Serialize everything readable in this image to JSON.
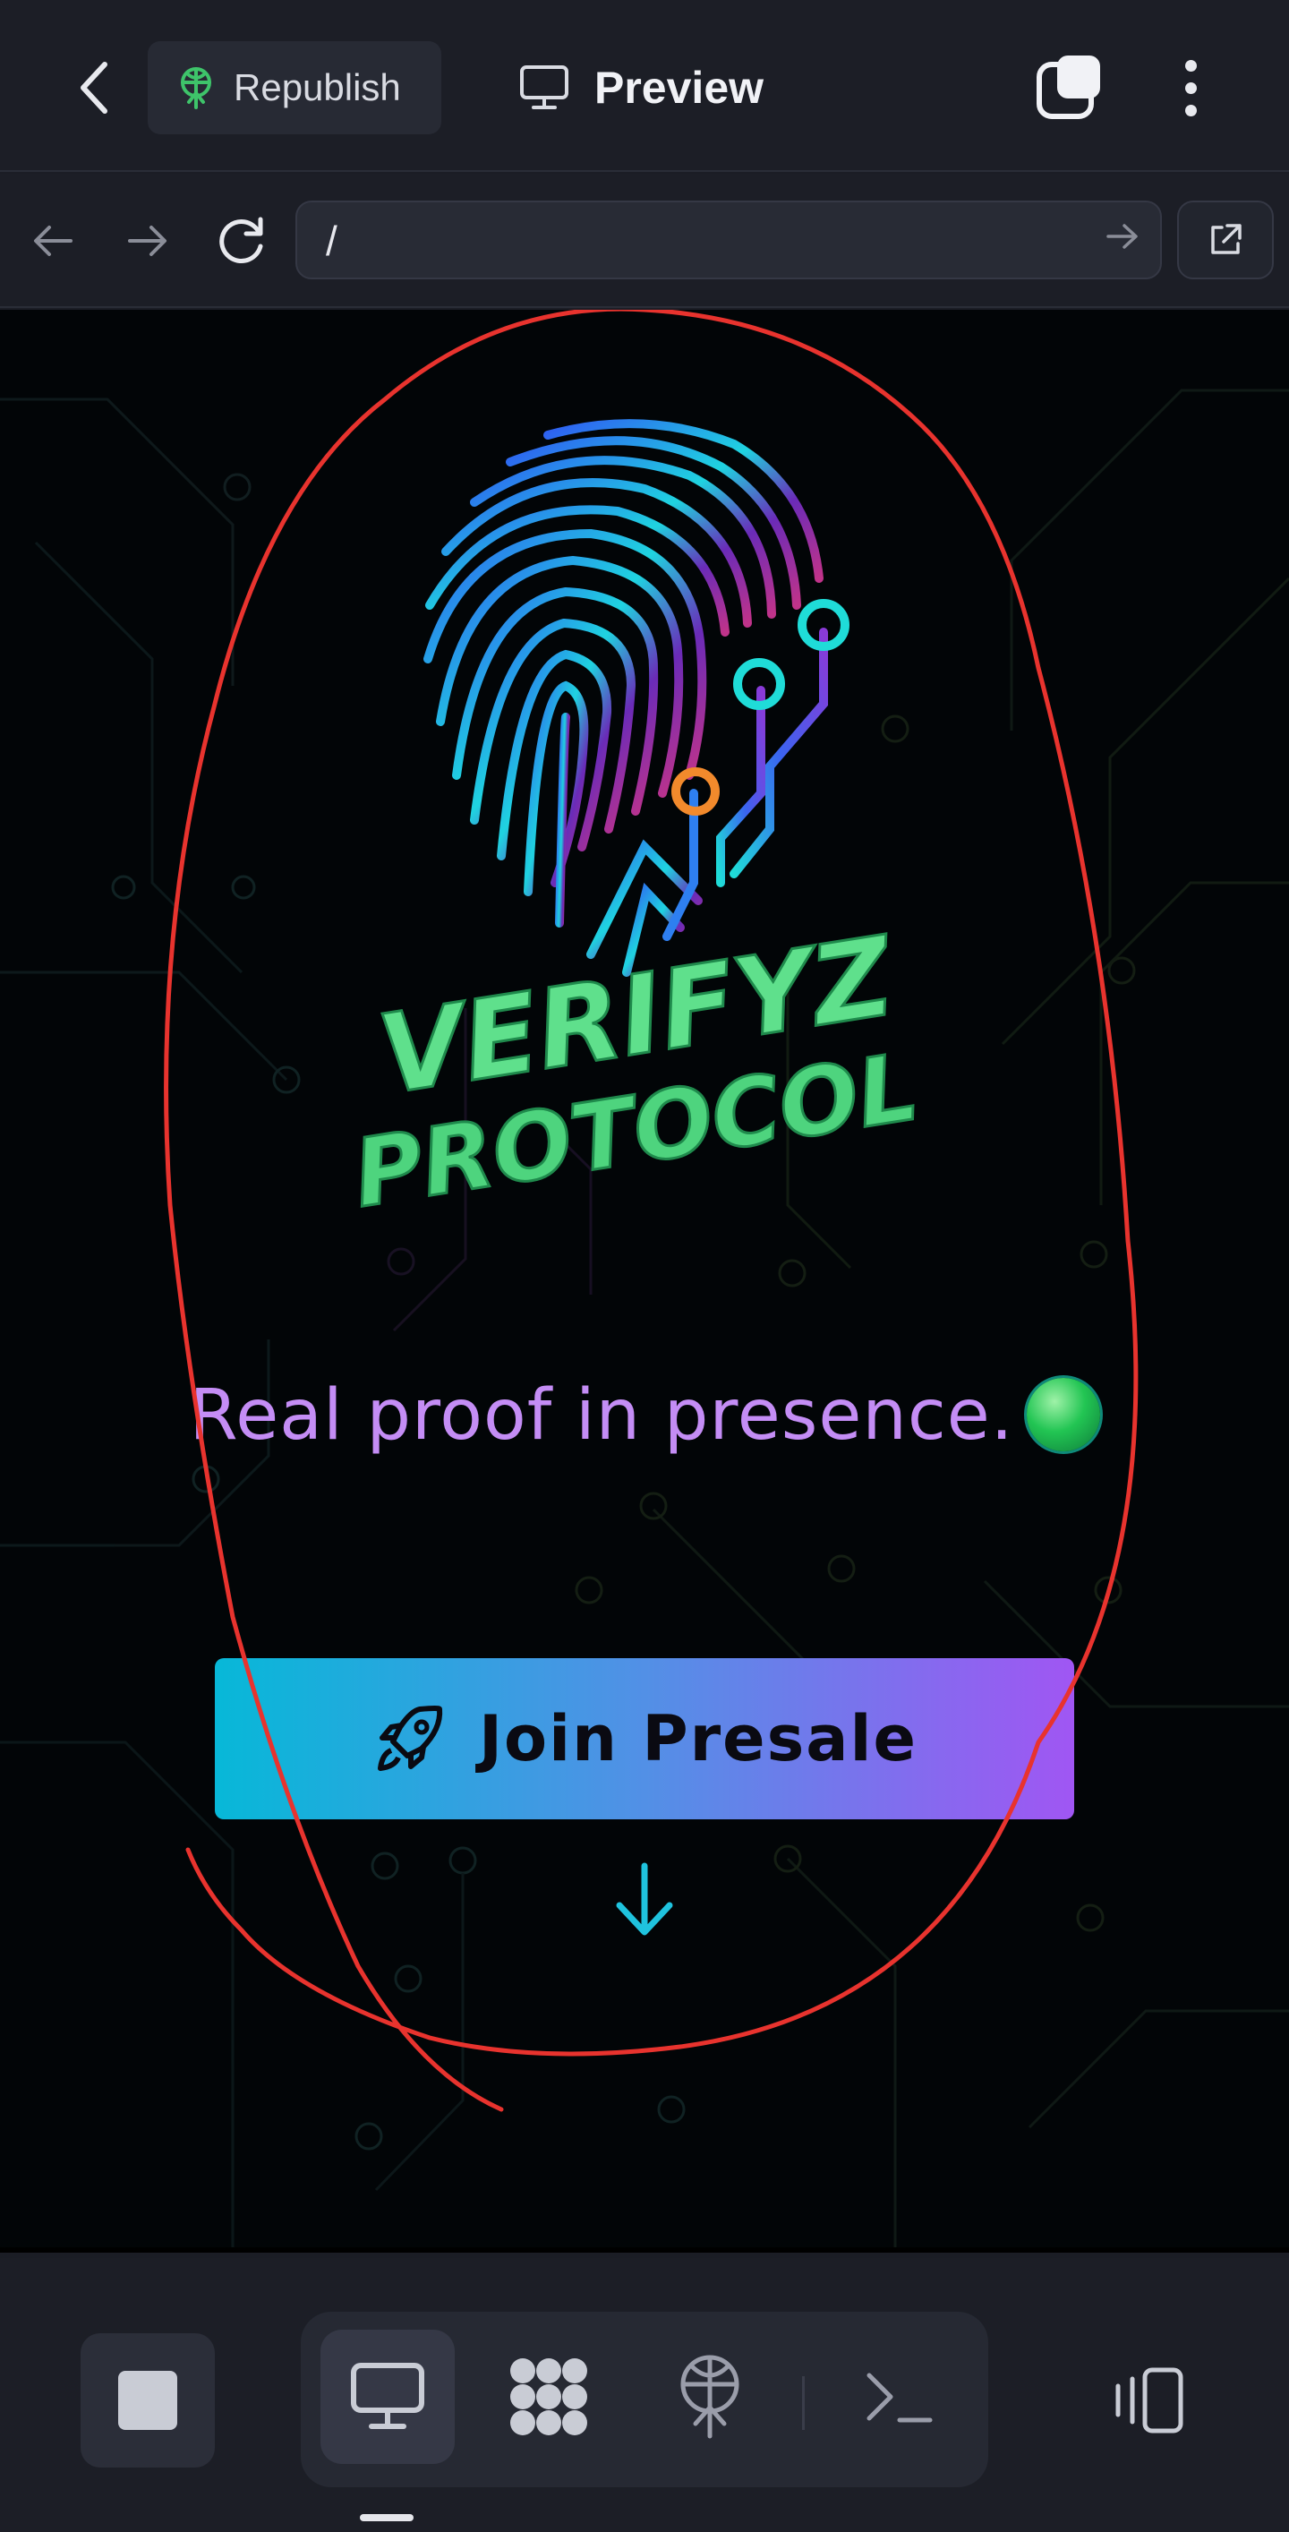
{
  "header": {
    "republish_label": "Republish",
    "preview_label": "Preview"
  },
  "navbar": {
    "url": "/"
  },
  "page": {
    "logo_text_line1": "VERIFYZ",
    "logo_text_line2": "PROTOCOL",
    "tagline": "Real proof in presence.",
    "presale_label": "Join Presale"
  },
  "colors": {
    "accent_green": "#4ade80",
    "tagline_purple": "#c48df5",
    "button_gradient_start": "#07b8d8",
    "button_gradient_end": "#a056f3",
    "annotation_red": "#e8332e"
  },
  "icons": {
    "back": "chevron-left-icon",
    "republish": "globe-antenna-icon",
    "preview": "monitor-icon",
    "tabs": "tabs-icon",
    "menu": "more-vertical-icon",
    "nav_back": "arrow-left-icon",
    "nav_forward": "arrow-right-icon",
    "reload": "reload-icon",
    "go": "arrow-right-icon",
    "open_external": "external-link-icon",
    "rocket": "rocket-icon",
    "scroll": "arrow-down-icon",
    "stop": "stop-icon",
    "desktop": "monitor-icon",
    "integrations": "grid-blob-icon",
    "deploy": "globe-antenna-icon",
    "console": "terminal-icon",
    "device": "device-switch-icon"
  }
}
